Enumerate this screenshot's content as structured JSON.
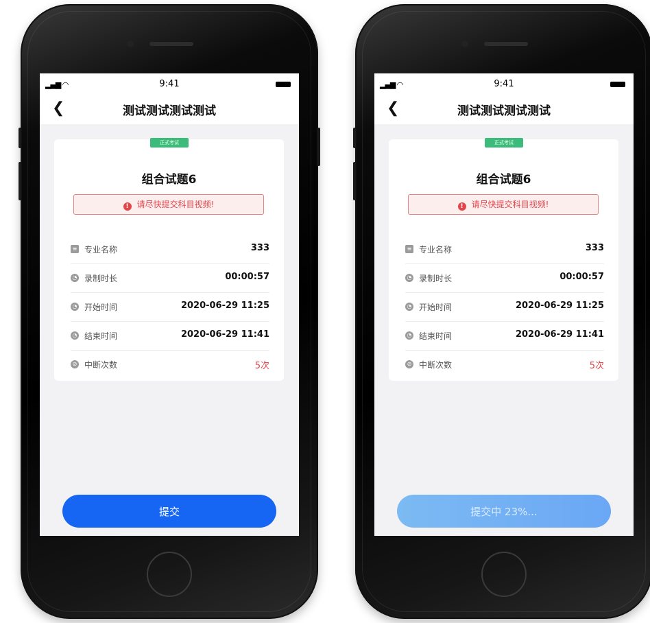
{
  "colors": {
    "primary": "#1765f3",
    "loading_start": "#7cbaf3",
    "warning": "#e0454b",
    "tag": "#3dbb7a"
  },
  "phones": [
    {
      "status": {
        "signal_icon": "signal-wifi-icon",
        "time": "9:41",
        "battery_icon": "battery-icon"
      },
      "nav": {
        "back_icon": "chevron-left-icon",
        "title": "测试测试测试测试"
      },
      "card": {
        "tag": "正式考试",
        "title": "组合试题6",
        "warning": "请尽快提交科目视频!",
        "rows": [
          {
            "icon": "document-icon",
            "label": "专业名称",
            "value": "333"
          },
          {
            "icon": "clock-icon",
            "label": "录制时长",
            "value": "00:00:57"
          },
          {
            "icon": "clock-icon",
            "label": "开始时间",
            "value": "2020-06-29 11:25"
          },
          {
            "icon": "clock-icon",
            "label": "结束时间",
            "value": "2020-06-29 11:41"
          },
          {
            "icon": "interrupt-icon",
            "label": "中断次数",
            "value": "5次"
          }
        ]
      },
      "button": {
        "label": "提交",
        "state": "default"
      }
    },
    {
      "status": {
        "signal_icon": "signal-wifi-icon",
        "time": "9:41",
        "battery_icon": "battery-icon"
      },
      "nav": {
        "back_icon": "chevron-left-icon",
        "title": "测试测试测试测试"
      },
      "card": {
        "tag": "正式考试",
        "title": "组合试题6",
        "warning": "请尽快提交科目视频!",
        "rows": [
          {
            "icon": "document-icon",
            "label": "专业名称",
            "value": "333"
          },
          {
            "icon": "clock-icon",
            "label": "录制时长",
            "value": "00:00:57"
          },
          {
            "icon": "clock-icon",
            "label": "开始时间",
            "value": "2020-06-29 11:25"
          },
          {
            "icon": "clock-icon",
            "label": "结束时间",
            "value": "2020-06-29 11:41"
          },
          {
            "icon": "interrupt-icon",
            "label": "中断次数",
            "value": "5次"
          }
        ]
      },
      "button": {
        "label": "提交中  23%...",
        "state": "loading"
      }
    }
  ]
}
